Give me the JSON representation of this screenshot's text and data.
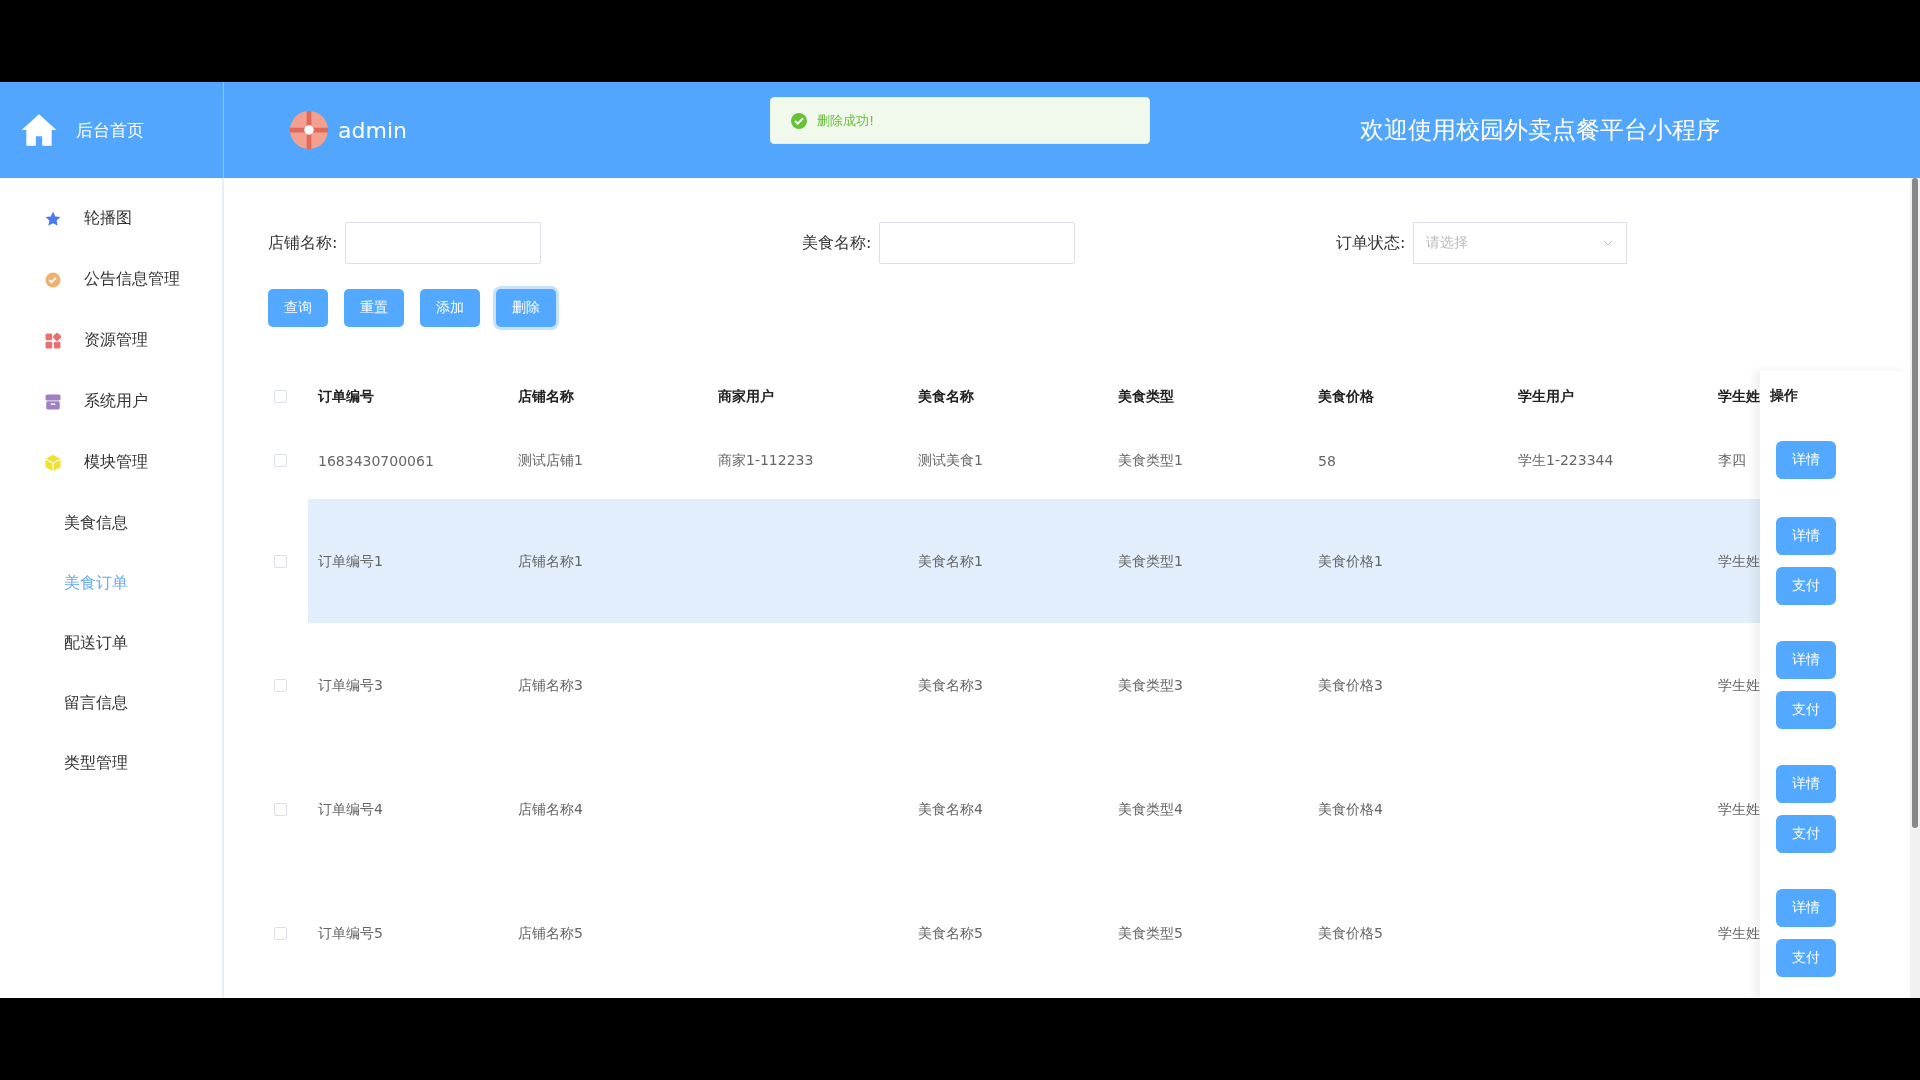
{
  "header": {
    "home_label": "后台首页",
    "user": "admin",
    "title": "欢迎使用校园外卖点餐平台小程序"
  },
  "toast": {
    "message": "删除成功!"
  },
  "sidebar": {
    "items": [
      {
        "label": "轮播图",
        "selected": false
      },
      {
        "label": "公告信息管理",
        "selected": false
      },
      {
        "label": "资源管理",
        "selected": false
      },
      {
        "label": "系统用户",
        "selected": false
      },
      {
        "label": "模块管理",
        "selected": false,
        "children": [
          {
            "label": "美食信息",
            "selected": false
          },
          {
            "label": "美食订单",
            "selected": true
          },
          {
            "label": "配送订单",
            "selected": false
          },
          {
            "label": "留言信息",
            "selected": false
          },
          {
            "label": "类型管理",
            "selected": false
          }
        ]
      }
    ]
  },
  "filters": [
    {
      "label": "店铺名称:",
      "kind": "input"
    },
    {
      "label": "美食名称:",
      "kind": "input"
    },
    {
      "label": "订单状态:",
      "kind": "select",
      "placeholder": "请选择"
    }
  ],
  "actions": [
    {
      "label": "查询",
      "focused": false
    },
    {
      "label": "重置",
      "focused": false
    },
    {
      "label": "添加",
      "focused": false
    },
    {
      "label": "删除",
      "focused": true
    }
  ],
  "table": {
    "select_all": {
      "checked": false
    },
    "columns": [
      "订单编号",
      "店铺名称",
      "商家用户",
      "美食名称",
      "美食类型",
      "美食价格",
      "学生用户",
      "学生姓"
    ],
    "ops_column": "操作",
    "rows": [
      {
        "checked": false,
        "highlighted": false,
        "cells": [
          "1683430700061",
          "测试店铺1",
          "商家1-112233",
          "测试美食1",
          "美食类型1",
          "58",
          "学生1-223344",
          "李四"
        ],
        "buttons": [
          "详情"
        ]
      },
      {
        "checked": false,
        "highlighted": true,
        "cells": [
          "订单编号1",
          "店铺名称1",
          "",
          "美食名称1",
          "美食类型1",
          "美食价格1",
          "",
          "学生姓"
        ],
        "buttons": [
          "详情",
          "支付"
        ]
      },
      {
        "checked": false,
        "highlighted": false,
        "cells": [
          "订单编号3",
          "店铺名称3",
          "",
          "美食名称3",
          "美食类型3",
          "美食价格3",
          "",
          "学生姓"
        ],
        "buttons": [
          "详情",
          "支付"
        ]
      },
      {
        "checked": false,
        "highlighted": false,
        "cells": [
          "订单编号4",
          "店铺名称4",
          "",
          "美食名称4",
          "美食类型4",
          "美食价格4",
          "",
          "学生姓"
        ],
        "buttons": [
          "详情",
          "支付"
        ]
      },
      {
        "checked": false,
        "highlighted": false,
        "cells": [
          "订单编号5",
          "店铺名称5",
          "",
          "美食名称5",
          "美食类型5",
          "美食价格5",
          "",
          "学生姓"
        ],
        "buttons": [
          "详情",
          "支付"
        ]
      }
    ]
  }
}
